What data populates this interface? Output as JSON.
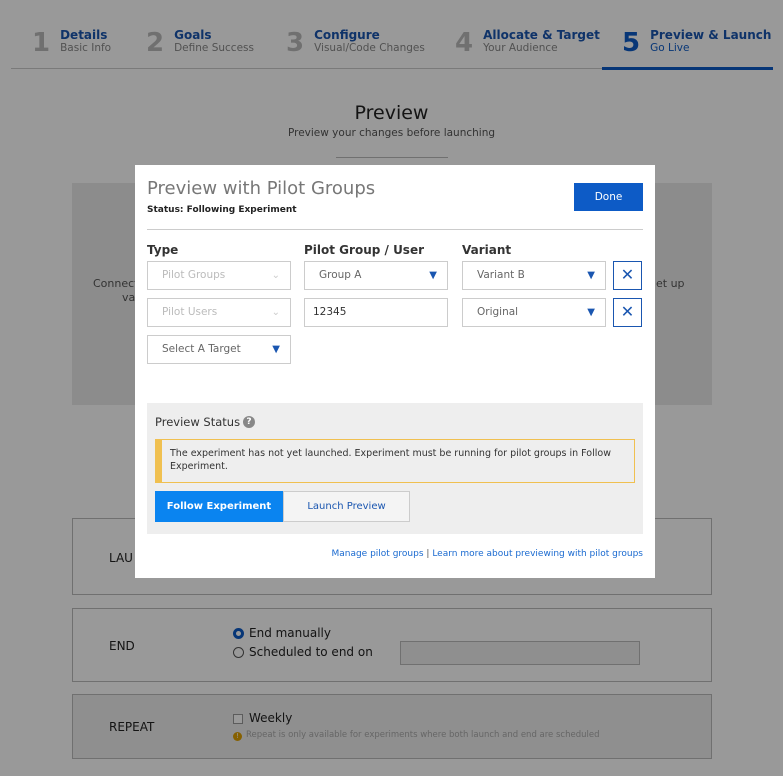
{
  "steps": [
    {
      "num": "1",
      "title": "Details",
      "sub": "Basic Info"
    },
    {
      "num": "2",
      "title": "Goals",
      "sub": "Define Success"
    },
    {
      "num": "3",
      "title": "Configure",
      "sub": "Visual/Code Changes"
    },
    {
      "num": "4",
      "title": "Allocate & Target",
      "sub": "Your Audience"
    },
    {
      "num": "5",
      "title": "Preview & Launch",
      "sub": "Go Live",
      "active": true
    }
  ],
  "page": {
    "title": "Preview",
    "subtitle": "Preview your changes before launching",
    "connect_fragment": "Connect",
    "variant_fragment": "varia",
    "setup_fragment": "et up"
  },
  "schedule": {
    "launch_label": "LAU",
    "end_label": "END",
    "end_manual": "End manually",
    "end_scheduled": "Scheduled to end on",
    "repeat_label": "REPEAT",
    "weekly": "Weekly",
    "repeat_note": "Repeat is only available for experiments where both launch and end are scheduled"
  },
  "modal": {
    "title": "Preview with Pilot Groups",
    "status": "Status: Following Experiment",
    "done": "Done",
    "col_type": "Type",
    "col_group": "Pilot Group / User",
    "col_variant": "Variant",
    "rows": [
      {
        "type": "Pilot Groups",
        "group": "Group A",
        "variant": "Variant B"
      },
      {
        "type": "Pilot Users",
        "group": "12345",
        "variant": "Original"
      }
    ],
    "target_placeholder": "Select A Target",
    "preview_status": "Preview Status",
    "warning": "The experiment has not yet launched. Experiment must be running for pilot groups in Follow Experiment.",
    "follow": "Follow Experiment",
    "launch": "Launch Preview",
    "link_manage": "Manage pilot groups",
    "separator": "|",
    "link_learn": "Learn more about previewing with pilot groups"
  },
  "colors": {
    "accent": "#0d5bc6",
    "follow_active": "#0a84f0",
    "warning_border": "#f0c050"
  }
}
